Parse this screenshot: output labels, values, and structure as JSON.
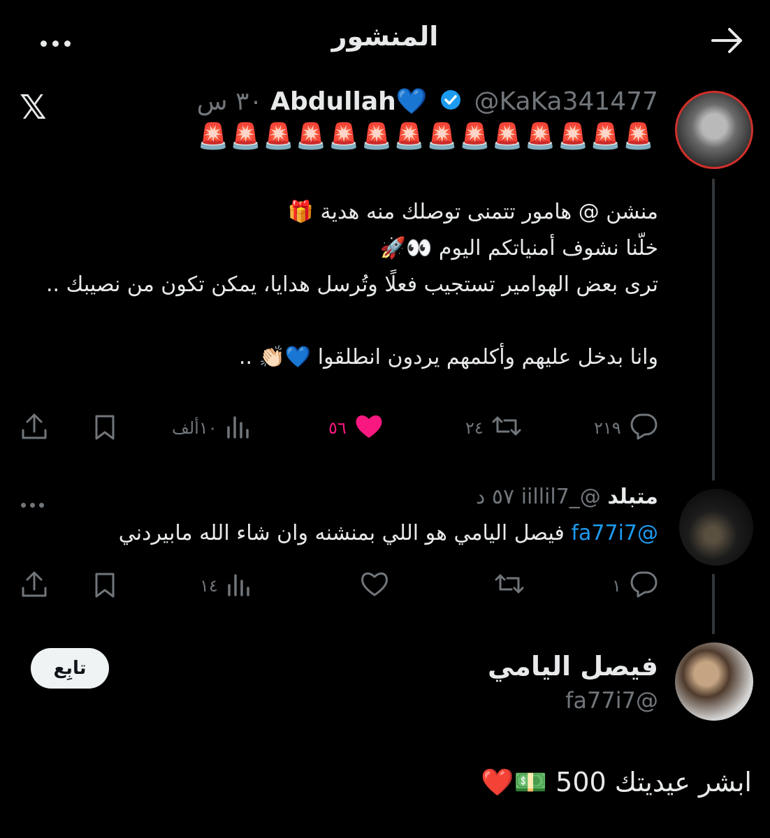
{
  "header": {
    "title": "المنشور"
  },
  "tweet": {
    "name": "Abdullah💙",
    "handle": "@KaKa341477",
    "time": "٣٠ س",
    "sirens": "🚨🚨🚨🚨🚨🚨🚨🚨🚨🚨🚨🚨🚨🚨",
    "body": "منشن @ هامور تتمنى توصلك منه هدية 🎁\nخلّنا نشوف أمنياتكم اليوم 👀🚀\nترى بعض الهوامير تستجيب فعلًا وتُرسل هدايا، يمكن تكون من نصيبك ..\n\nوانا بدخل عليهم وأكلمهم يردون انطلقوا 💙👏🏻 ..",
    "replies": "٢١٩",
    "reposts": "٢٤",
    "likes": "٥٦",
    "views": "١٠ألف"
  },
  "reply_tweet": {
    "name": "متبلد",
    "handle": "@_iillil7",
    "time": "٥٧ د",
    "mention": "@fa77i7",
    "text": "فيصل اليامي هو اللي بمنشنه وان شاء الله مابيردني",
    "replies": "١",
    "views": "١٤"
  },
  "profile_card": {
    "name": "فيصل اليامي",
    "handle": "@fa77i7",
    "follow_label": "تابِع"
  },
  "caption": "ابشر عيديتك 500 💵❤️",
  "colors": {
    "background": "#000000",
    "muted": "#71767b",
    "like": "#f91880",
    "verified": "#1d9bf0"
  }
}
